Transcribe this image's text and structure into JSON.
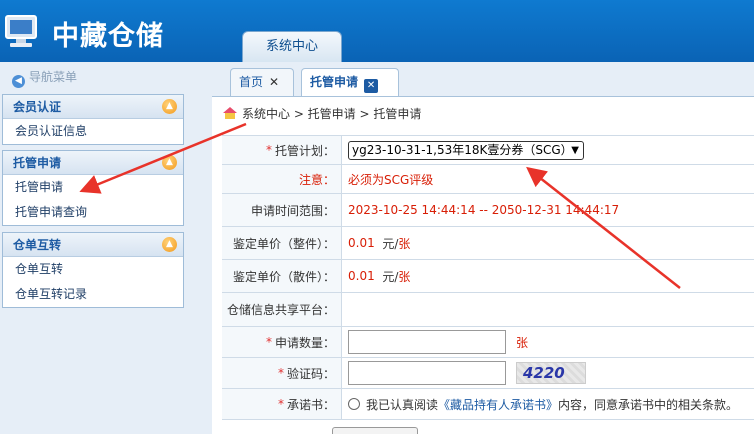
{
  "header": {
    "logo_text": "中藏仓储",
    "top_tab": "系统中心"
  },
  "sidebar": {
    "nav_title": "导航菜单",
    "groups": [
      {
        "title": "会员认证",
        "items": [
          "会员认证信息"
        ]
      },
      {
        "title": "托管申请",
        "items": [
          "托管申请",
          "托管申请查询"
        ]
      },
      {
        "title": "仓单互转",
        "items": [
          "仓单互转",
          "仓单互转记录"
        ]
      }
    ]
  },
  "tabs": {
    "home": "首页",
    "active": "托管申请"
  },
  "breadcrumb": "系统中心 > 托管申请 > 托管申请",
  "form": {
    "plan_label": "托管计划：",
    "plan_value": "yg23-10-31-1,53年18K壹分券（SCG）",
    "note_label": "注意：",
    "note_value": "必须为SCG评级",
    "time_label": "申请时间范围：",
    "time_value": "2023-10-25 14:44:14 -- 2050-12-31 14:44:17",
    "price_whole_label": "鉴定单价（整件）：",
    "price_whole_value": "0.01",
    "price_whole_unit": "元/",
    "price_whole_unit2": "张",
    "price_loose_label": "鉴定单价（散件）：",
    "price_loose_value": "0.01",
    "price_loose_unit": "元/",
    "price_loose_unit2": "张",
    "platform_label": "仓储信息共享平台：",
    "qty_label": "申请数量：",
    "qty_unit": "张",
    "code_label": "验证码：",
    "captcha_text": "4220",
    "promise_label": "承诺书：",
    "promise_prefix": "我已认真阅读",
    "promise_link": "《藏品持有人承诺书》",
    "promise_suffix": "内容，同意承诺书中的相关条款。"
  },
  "colors": {
    "header_blue": "#0a63b5",
    "accent_red": "#d81e06",
    "arrow_red": "#e8332a"
  }
}
